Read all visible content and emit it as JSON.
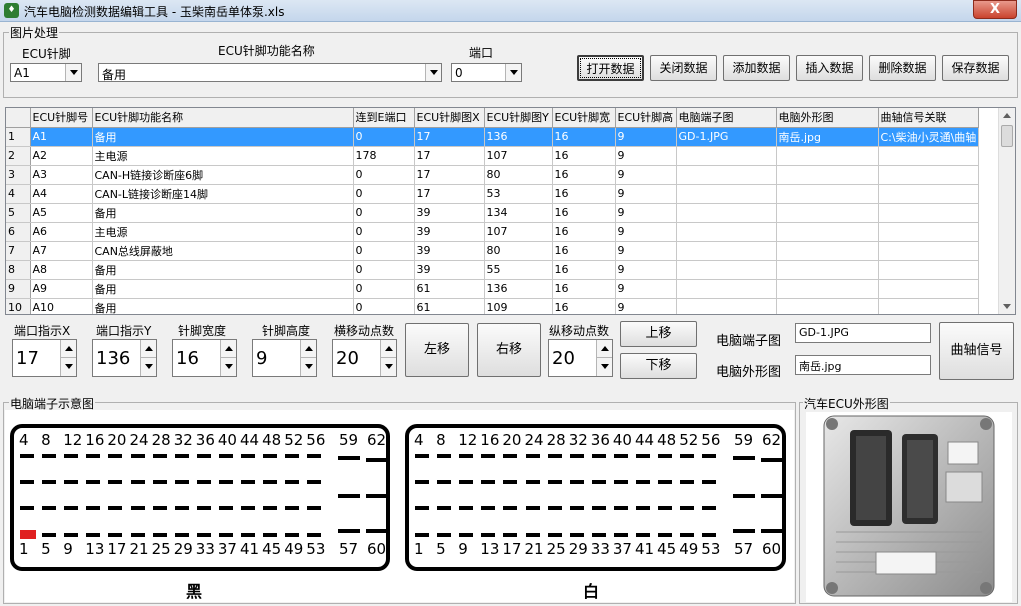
{
  "window": {
    "title": "汽车电脑检测数据编辑工具 - 玉柴南岳单体泵.xls",
    "close": "X"
  },
  "group_image": "图片处理",
  "labels": {
    "ecu_pin": "ECU针脚",
    "ecu_func": "ECU针脚功能名称",
    "port": "端口"
  },
  "combos": {
    "ecu_pin": "A1",
    "ecu_func": "备用",
    "port": "0"
  },
  "buttons": [
    "打开数据",
    "关闭数据",
    "添加数据",
    "插入数据",
    "删除数据",
    "保存数据"
  ],
  "table": {
    "headers": [
      "ECU针脚号",
      "ECU针脚功能名称",
      "连到E端口",
      "ECU针脚图X",
      "ECU针脚图Y",
      "ECU针脚宽",
      "ECU针脚高",
      "电脑端子图",
      "电脑外形图",
      "曲轴信号关联"
    ],
    "rows": [
      [
        "1",
        "A1",
        "备用",
        "0",
        "17",
        "136",
        "16",
        "9",
        "GD-1.JPG",
        "南岳.jpg",
        "C:\\柴油小灵通\\曲轴"
      ],
      [
        "2",
        "A2",
        "主电源",
        "178",
        "17",
        "107",
        "16",
        "9",
        "",
        "",
        ""
      ],
      [
        "3",
        "A3",
        "CAN-H链接诊断座6脚",
        "0",
        "17",
        "80",
        "16",
        "9",
        "",
        "",
        ""
      ],
      [
        "4",
        "A4",
        "CAN-L链接诊断座14脚",
        "0",
        "17",
        "53",
        "16",
        "9",
        "",
        "",
        ""
      ],
      [
        "5",
        "A5",
        "备用",
        "0",
        "39",
        "134",
        "16",
        "9",
        "",
        "",
        ""
      ],
      [
        "6",
        "A6",
        "主电源",
        "0",
        "39",
        "107",
        "16",
        "9",
        "",
        "",
        ""
      ],
      [
        "7",
        "A7",
        "CAN总线屏蔽地",
        "0",
        "39",
        "80",
        "16",
        "9",
        "",
        "",
        ""
      ],
      [
        "8",
        "A8",
        "备用",
        "0",
        "39",
        "55",
        "16",
        "9",
        "",
        "",
        ""
      ],
      [
        "9",
        "A9",
        "备用",
        "0",
        "61",
        "136",
        "16",
        "9",
        "",
        "",
        ""
      ],
      [
        "10",
        "A10",
        "备用",
        "0",
        "61",
        "109",
        "16",
        "9",
        "",
        "",
        ""
      ]
    ]
  },
  "controls": {
    "port_x_label": "端口指示X",
    "port_x": "17",
    "port_y_label": "端口指示Y",
    "port_y": "136",
    "pin_w_label": "针脚宽度",
    "pin_w": "16",
    "pin_h_label": "针脚高度",
    "pin_h": "9",
    "hstep_label": "横移动点数",
    "hstep": "20",
    "left": "左移",
    "right": "右移",
    "vstep_label": "纵移动点数",
    "vstep": "20",
    "up": "上移",
    "down": "下移",
    "term_img_label": "电脑端子图",
    "term_img": "GD-1.JPG",
    "shape_img_label": "电脑外形图",
    "shape_img": "南岳.jpg",
    "crank": "曲轴信号"
  },
  "diagram": {
    "title": "电脑端子示意图",
    "top_pins": [
      "4",
      "8",
      "12",
      "16",
      "20",
      "24",
      "28",
      "32",
      "36",
      "40",
      "44",
      "48",
      "52",
      "56",
      "59",
      "62"
    ],
    "bottom_pins": [
      "1",
      "5",
      "9",
      "13",
      "17",
      "21",
      "25",
      "29",
      "33",
      "37",
      "41",
      "45",
      "49",
      "53",
      "57",
      "60"
    ],
    "left_label": "黑",
    "right_label": "白",
    "highlight_color": "#e02020"
  },
  "ecu_photo_title": "汽车ECU外形图",
  "colors": {
    "selection": "#3399ff"
  }
}
